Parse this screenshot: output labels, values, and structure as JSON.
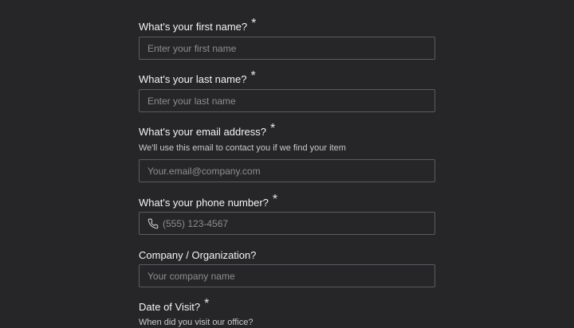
{
  "fields": [
    {
      "label": "What's your first name?",
      "required": "*",
      "placeholder": "Enter your first name"
    },
    {
      "label": "What's your last name?",
      "required": "*",
      "placeholder": "Enter your last name"
    },
    {
      "label": "What's your email address?",
      "required": "*",
      "helper": "We'll use this email to contact you if we find your item",
      "placeholder": "Your.email@company.com"
    },
    {
      "label": "What's your phone number?",
      "required": "*",
      "placeholder": "(555) 123-4567",
      "icon": "phone-icon"
    },
    {
      "label": "Company / Organization?",
      "placeholder": "Your company name"
    },
    {
      "label": "Date of Visit?",
      "required": "*",
      "helper": "When did you visit our office?"
    }
  ]
}
